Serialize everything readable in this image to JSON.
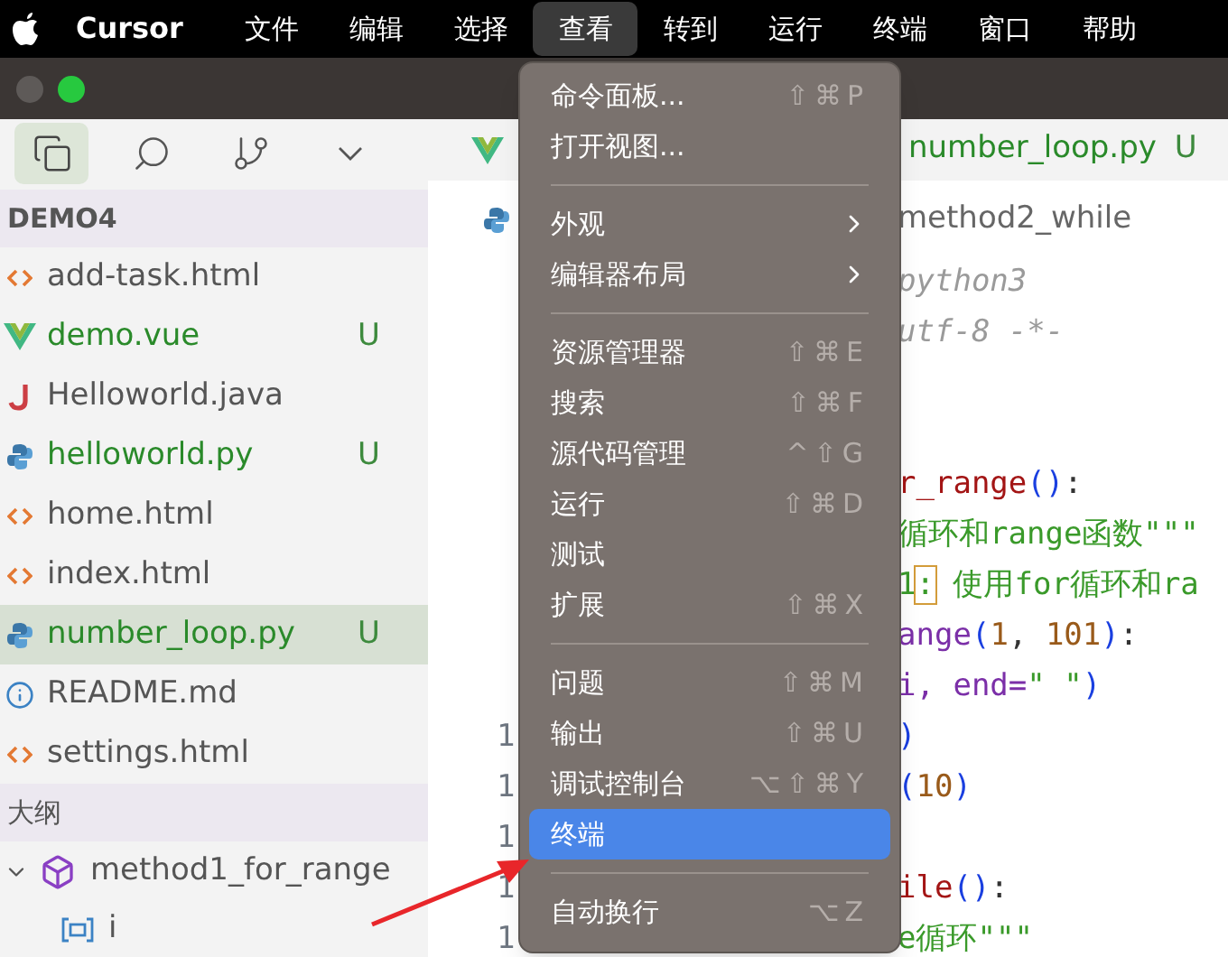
{
  "menu_bar": {
    "app": "Cursor",
    "items": [
      {
        "label": "文件",
        "selected": false
      },
      {
        "label": "编辑",
        "selected": false
      },
      {
        "label": "选择",
        "selected": false
      },
      {
        "label": "查看",
        "selected": true
      },
      {
        "label": "转到",
        "selected": false
      },
      {
        "label": "运行",
        "selected": false
      },
      {
        "label": "终端",
        "selected": false
      },
      {
        "label": "窗口",
        "selected": false
      },
      {
        "label": "帮助",
        "selected": false
      }
    ]
  },
  "activity_bar": {
    "items": [
      {
        "kind": "files",
        "selected": true
      },
      {
        "kind": "search",
        "selected": false
      },
      {
        "kind": "source-control",
        "selected": false
      },
      {
        "kind": "more",
        "selected": false
      }
    ]
  },
  "explorer": {
    "title": "DEMO4",
    "files": [
      {
        "name": "add-task.html",
        "kind": "html",
        "untracked": false,
        "selected": false
      },
      {
        "name": "demo.vue",
        "kind": "vue",
        "untracked": true,
        "status": "U",
        "selected": false
      },
      {
        "name": "Helloworld.java",
        "kind": "java",
        "untracked": false,
        "selected": false
      },
      {
        "name": "helloworld.py",
        "kind": "python",
        "untracked": true,
        "status": "U",
        "selected": false
      },
      {
        "name": "home.html",
        "kind": "html",
        "untracked": false,
        "selected": false
      },
      {
        "name": "index.html",
        "kind": "html",
        "untracked": false,
        "selected": false
      },
      {
        "name": "number_loop.py",
        "kind": "python",
        "untracked": true,
        "status": "U",
        "selected": true
      },
      {
        "name": "README.md",
        "kind": "info",
        "untracked": false,
        "selected": false
      },
      {
        "name": "settings.html",
        "kind": "html",
        "untracked": false,
        "selected": false
      }
    ]
  },
  "outline": {
    "title": "大纲",
    "items": [
      {
        "name": "method1_for_range",
        "kind": "method",
        "expanded": true,
        "children": [
          {
            "name": "i",
            "kind": "variable"
          }
        ]
      }
    ]
  },
  "editor": {
    "tab": {
      "name": "number_loop.py",
      "status": "U"
    },
    "breadcrumb": "method2_while",
    "lines": [
      {
        "tokens": [
          {
            "text": "python3",
            "kind": "comment"
          }
        ]
      },
      {
        "tokens": [
          {
            "text": "utf-8 -*-",
            "kind": "comment"
          }
        ]
      },
      {
        "kind": "blank"
      },
      {
        "kind": "blank"
      },
      {
        "tokens": [
          {
            "text": "r_range",
            "kind": "function"
          },
          {
            "text": "()",
            "kind": "paren"
          },
          {
            "text": ":",
            "kind": "plain"
          }
        ]
      },
      {
        "tokens": [
          {
            "text": "循环和range函数\"\"\"",
            "kind": "string"
          }
        ]
      },
      {
        "tokens": [
          {
            "text": "1",
            "kind": "string"
          },
          {
            "text": ":",
            "kind": "match"
          },
          {
            "text": " 使用for循环和ra",
            "kind": "string"
          }
        ]
      },
      {
        "tokens": [
          {
            "text": "ange",
            "kind": "builtin"
          },
          {
            "text": "(",
            "kind": "paren"
          },
          {
            "text": "1",
            "kind": "number"
          },
          {
            "text": ", ",
            "kind": "plain"
          },
          {
            "text": "101",
            "kind": "number"
          },
          {
            "text": ")",
            "kind": "paren"
          },
          {
            "text": ":",
            "kind": "plain"
          }
        ]
      },
      {
        "tokens": [
          {
            "text": "i, end=",
            "kind": "builtin"
          },
          {
            "text": "\" \"",
            "kind": "string"
          },
          {
            "text": ")",
            "kind": "paren"
          }
        ]
      },
      {
        "number": "1",
        "tokens": [
          {
            "text": ")",
            "kind": "paren"
          }
        ]
      },
      {
        "number": "1",
        "tokens": [
          {
            "text": "(",
            "kind": "paren"
          },
          {
            "text": "10",
            "kind": "number"
          },
          {
            "text": ")",
            "kind": "paren"
          }
        ]
      },
      {
        "kind": "blank",
        "number": "1"
      },
      {
        "number": "1",
        "tokens": [
          {
            "text": "ile",
            "kind": "function"
          },
          {
            "text": "()",
            "kind": "paren"
          },
          {
            "text": ":",
            "kind": "plain"
          }
        ]
      },
      {
        "number": "1",
        "tokens": [
          {
            "text": "e循环\"\"\"",
            "kind": "string"
          }
        ]
      }
    ]
  },
  "view_menu": {
    "items": [
      {
        "kind": "item",
        "label": "命令面板...",
        "shortcut": "⇧⌘P",
        "selected": false
      },
      {
        "kind": "item",
        "label": "打开视图...",
        "selected": false
      },
      {
        "kind": "separator"
      },
      {
        "kind": "submenu",
        "label": "外观",
        "selected": false
      },
      {
        "kind": "submenu",
        "label": "编辑器布局",
        "selected": false
      },
      {
        "kind": "separator"
      },
      {
        "kind": "item",
        "label": "资源管理器",
        "shortcut": "⇧⌘E",
        "selected": false
      },
      {
        "kind": "item",
        "label": "搜索",
        "shortcut": "⇧⌘F",
        "selected": false
      },
      {
        "kind": "item",
        "label": "源代码管理",
        "shortcut": "^⇧G",
        "selected": false
      },
      {
        "kind": "item",
        "label": "运行",
        "shortcut": "⇧⌘D",
        "selected": false
      },
      {
        "kind": "item",
        "label": "测试",
        "selected": false
      },
      {
        "kind": "item",
        "label": "扩展",
        "shortcut": "⇧⌘X",
        "selected": false
      },
      {
        "kind": "separator"
      },
      {
        "kind": "item",
        "label": "问题",
        "shortcut": "⇧⌘M",
        "selected": false
      },
      {
        "kind": "item",
        "label": "输出",
        "shortcut": "⇧⌘U",
        "selected": false
      },
      {
        "kind": "item",
        "label": "调试控制台",
        "shortcut": "⌥⇧⌘Y",
        "selected": false
      },
      {
        "kind": "item",
        "label": "终端",
        "selected": true
      },
      {
        "kind": "separator"
      },
      {
        "kind": "item",
        "label": "自动换行",
        "shortcut": "⌥Z",
        "selected": false
      }
    ]
  }
}
